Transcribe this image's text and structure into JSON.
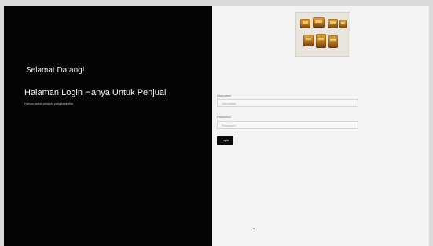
{
  "left_panel": {
    "welcome_text": "Selamat Datang!",
    "heading": "Halaman Login Hanya Untuk Penjual",
    "note": "Hanya untuk penjual yang terdaftar"
  },
  "right_panel": {
    "product_image": {
      "icon": "product-photo"
    },
    "username": {
      "label": "Username",
      "placeholder": "Username"
    },
    "password": {
      "label": "Password",
      "placeholder": "Password"
    },
    "login_button": "Login"
  },
  "colors": {
    "left_background": "#050505",
    "right_background": "#f3f3f3",
    "button_background": "#0b0b0b"
  }
}
